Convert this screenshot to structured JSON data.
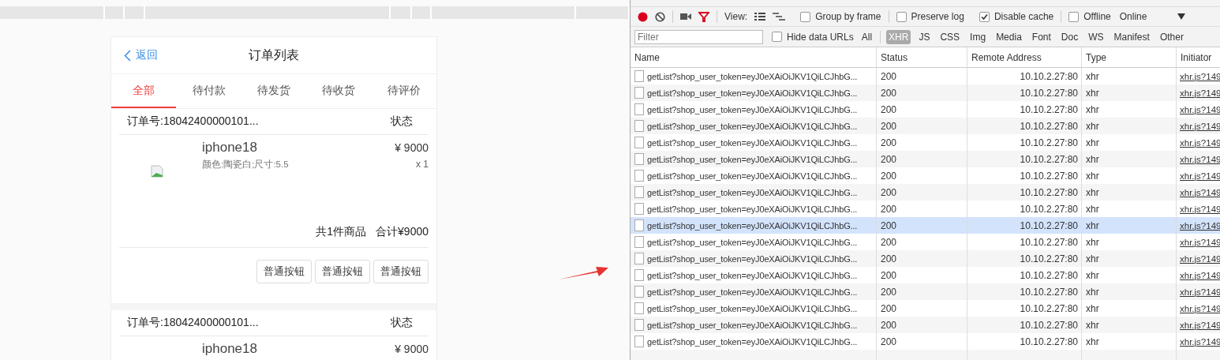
{
  "app": {
    "back": "返回",
    "title": "订单列表",
    "tabs": [
      {
        "label": "全部",
        "selected": true
      },
      {
        "label": "待付款",
        "selected": false
      },
      {
        "label": "待发货",
        "selected": false
      },
      {
        "label": "待收货",
        "selected": false
      },
      {
        "label": "待评价",
        "selected": false
      }
    ],
    "orders": [
      {
        "order_no": "订单号:18042400000101...",
        "status": "状态",
        "items": [
          {
            "name": "iphone18",
            "spec": "颜色:陶瓷白;尺寸:5.5",
            "price": "¥ 9000",
            "qty": "x 1"
          }
        ],
        "count": "共1件商品",
        "total": "合计¥9000",
        "buttons": [
          "普通按钮",
          "普通按钮",
          "普通按钮"
        ]
      },
      {
        "order_no": "订单号:18042400000101...",
        "status": "状态",
        "items": [
          {
            "name": "iphone18",
            "price": "¥ 9000"
          }
        ]
      }
    ]
  },
  "devtools": {
    "toolbar": {
      "recording": true,
      "view_label": "View:",
      "checkboxes": [
        {
          "label": "Group by frame",
          "checked": false,
          "divider_before": false
        },
        {
          "label": "Preserve log",
          "checked": false,
          "divider_before": true
        },
        {
          "label": "Disable cache",
          "checked": true,
          "divider_before": false
        },
        {
          "label": "Offline",
          "checked": false,
          "divider_before": true
        }
      ],
      "throttle": "Online"
    },
    "filter": {
      "placeholder": "Filter",
      "hide_data_urls": {
        "label": "Hide data URLs",
        "checked": false
      },
      "types": [
        {
          "label": "All",
          "selected": false
        },
        {
          "label": "XHR",
          "selected": true
        },
        {
          "label": "JS",
          "selected": false
        },
        {
          "label": "CSS",
          "selected": false
        },
        {
          "label": "Img",
          "selected": false
        },
        {
          "label": "Media",
          "selected": false
        },
        {
          "label": "Font",
          "selected": false
        },
        {
          "label": "Doc",
          "selected": false
        },
        {
          "label": "WS",
          "selected": false
        },
        {
          "label": "Manifest",
          "selected": false
        },
        {
          "label": "Other",
          "selected": false
        }
      ]
    },
    "columns": [
      "Name",
      "Status",
      "Remote Address",
      "Type",
      "Initiator"
    ],
    "rows": [
      {
        "name": "getList?shop_user_token=eyJ0eXAiOiJKV1QiLCJhbG...",
        "status": "200",
        "address": "10.10.2.27:80",
        "type": "xhr",
        "initiator": "xhr.js?149",
        "selected": false
      },
      {
        "name": "getList?shop_user_token=eyJ0eXAiOiJKV1QiLCJhbG...",
        "status": "200",
        "address": "10.10.2.27:80",
        "type": "xhr",
        "initiator": "xhr.js?149",
        "selected": false
      },
      {
        "name": "getList?shop_user_token=eyJ0eXAiOiJKV1QiLCJhbG...",
        "status": "200",
        "address": "10.10.2.27:80",
        "type": "xhr",
        "initiator": "xhr.js?149",
        "selected": false
      },
      {
        "name": "getList?shop_user_token=eyJ0eXAiOiJKV1QiLCJhbG...",
        "status": "200",
        "address": "10.10.2.27:80",
        "type": "xhr",
        "initiator": "xhr.js?149",
        "selected": false
      },
      {
        "name": "getList?shop_user_token=eyJ0eXAiOiJKV1QiLCJhbG...",
        "status": "200",
        "address": "10.10.2.27:80",
        "type": "xhr",
        "initiator": "xhr.js?149",
        "selected": false
      },
      {
        "name": "getList?shop_user_token=eyJ0eXAiOiJKV1QiLCJhbG...",
        "status": "200",
        "address": "10.10.2.27:80",
        "type": "xhr",
        "initiator": "xhr.js?149",
        "selected": false
      },
      {
        "name": "getList?shop_user_token=eyJ0eXAiOiJKV1QiLCJhbG...",
        "status": "200",
        "address": "10.10.2.27:80",
        "type": "xhr",
        "initiator": "xhr.js?149",
        "selected": false
      },
      {
        "name": "getList?shop_user_token=eyJ0eXAiOiJKV1QiLCJhbG...",
        "status": "200",
        "address": "10.10.2.27:80",
        "type": "xhr",
        "initiator": "xhr.js?149",
        "selected": false
      },
      {
        "name": "getList?shop_user_token=eyJ0eXAiOiJKV1QiLCJhbG...",
        "status": "200",
        "address": "10.10.2.27:80",
        "type": "xhr",
        "initiator": "xhr.js?149",
        "selected": false
      },
      {
        "name": "getList?shop_user_token=eyJ0eXAiOiJKV1QiLCJhbG...",
        "status": "200",
        "address": "10.10.2.27:80",
        "type": "xhr",
        "initiator": "xhr.js?149",
        "selected": true
      },
      {
        "name": "getList?shop_user_token=eyJ0eXAiOiJKV1QiLCJhbG...",
        "status": "200",
        "address": "10.10.2.27:80",
        "type": "xhr",
        "initiator": "xhr.js?149",
        "selected": false
      },
      {
        "name": "getList?shop_user_token=eyJ0eXAiOiJKV1QiLCJhbG...",
        "status": "200",
        "address": "10.10.2.27:80",
        "type": "xhr",
        "initiator": "xhr.js?149",
        "selected": false
      },
      {
        "name": "getList?shop_user_token=eyJ0eXAiOiJKV1QiLCJhbG...",
        "status": "200",
        "address": "10.10.2.27:80",
        "type": "xhr",
        "initiator": "xhr.js?149",
        "selected": false
      },
      {
        "name": "getList?shop_user_token=eyJ0eXAiOiJKV1QiLCJhbG...",
        "status": "200",
        "address": "10.10.2.27:80",
        "type": "xhr",
        "initiator": "xhr.js?149",
        "selected": false
      },
      {
        "name": "getList?shop_user_token=eyJ0eXAiOiJKV1QiLCJhbG...",
        "status": "200",
        "address": "10.10.2.27:80",
        "type": "xhr",
        "initiator": "xhr.js?149",
        "selected": false
      },
      {
        "name": "getList?shop_user_token=eyJ0eXAiOiJKV1QiLCJhbG...",
        "status": "200",
        "address": "10.10.2.27:80",
        "type": "xhr",
        "initiator": "xhr.js?149",
        "selected": false
      },
      {
        "name": "getList?shop_user_token=eyJ0eXAiOiJKV1QiLCJhbG...",
        "status": "200",
        "address": "10.10.2.27:80",
        "type": "xhr",
        "initiator": "xhr.js?149",
        "selected": false
      }
    ]
  }
}
